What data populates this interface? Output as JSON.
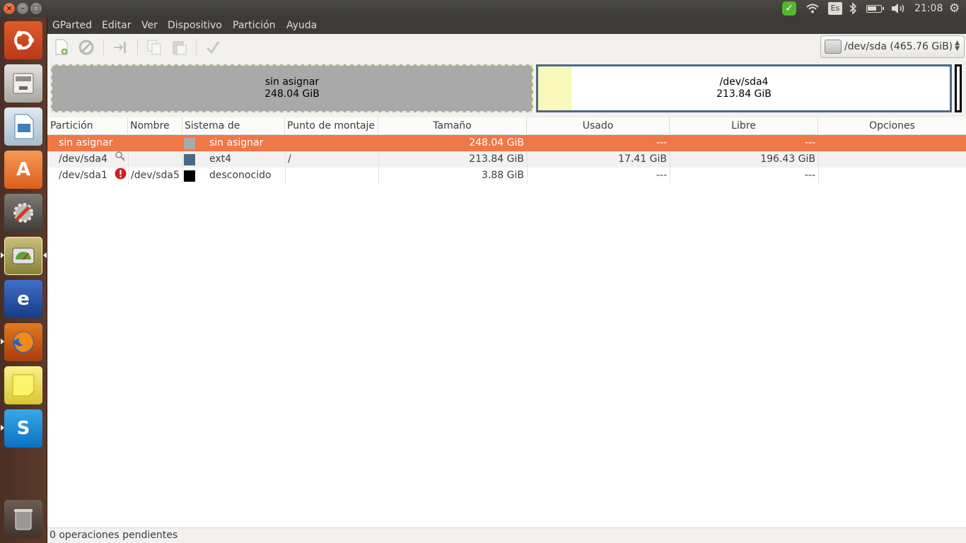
{
  "top_panel": {
    "clock": "21:08",
    "keyboard_layout": "Es"
  },
  "menubar": {
    "items": [
      "GParted",
      "Editar",
      "Ver",
      "Dispositivo",
      "Partición",
      "Ayuda"
    ]
  },
  "toolbar": {
    "device_label": "/dev/sda  (465.76 GiB)",
    "buttons": [
      "new-icon",
      "delete-icon",
      "resize-move-icon",
      "copy-icon",
      "paste-icon",
      "apply-icon"
    ]
  },
  "disk_graph": {
    "segments": [
      {
        "name": "sin asignar",
        "size": "248.04 GiB",
        "color": "#a9a9a9"
      },
      {
        "name": "/dev/sda4",
        "size": "213.84 GiB",
        "color": "#4b6983"
      },
      {
        "name": "/dev/sda1",
        "size": "",
        "color": "#000000"
      }
    ]
  },
  "table": {
    "headers": [
      "Partición",
      "Nombre",
      "Sistema de archivos",
      "Punto de montaje",
      "Tamaño",
      "Usado",
      "Libre",
      "Opciones"
    ],
    "rows": [
      {
        "partition": "sin asignar",
        "name": "",
        "filesystem": "sin asignar",
        "fs_color": "#a9a9a9",
        "mount": "",
        "size": "248.04 GiB",
        "used": "---",
        "free": "---",
        "flags": "",
        "selected": true
      },
      {
        "partition": "/dev/sda4",
        "name": "",
        "filesystem": "ext4",
        "fs_color": "#4b6983",
        "mount": "/",
        "size": "213.84 GiB",
        "used": "17.41 GiB",
        "free": "196.43 GiB",
        "flags": "",
        "icon": "key-icon"
      },
      {
        "partition": "/dev/sda1",
        "name": "/dev/sda5",
        "filesystem": "desconocido",
        "fs_color": "#000000",
        "mount": "",
        "size": "3.88 GiB",
        "used": "---",
        "free": "---",
        "flags": "",
        "icon": "warning-icon"
      }
    ]
  },
  "status": {
    "text": "0 operaciones pendientes"
  },
  "colors": {
    "selection": "#f07746",
    "launcher": "#5b3a2b",
    "panel": "#3c3b37"
  }
}
